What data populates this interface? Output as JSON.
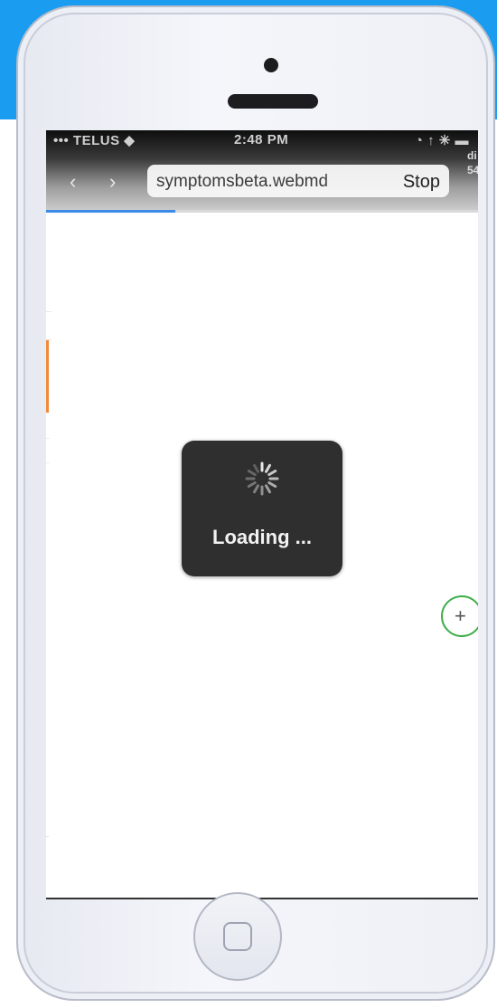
{
  "status_bar": {
    "carrier": "••• TELUS ◆",
    "time": "2:48 PM",
    "icons_text": "◔ ↑ ✳ ▬",
    "cut_label_1": "di",
    "cut_label_2": "54"
  },
  "browser": {
    "back_icon": "‹",
    "forward_icon": "›",
    "url": "symptomsbeta.webmd",
    "stop_label": "Stop",
    "progress_fraction": 0.3
  },
  "loading": {
    "text": "Loading ..."
  },
  "fab": {
    "label": "+"
  },
  "colors": {
    "accent_background": "#1a9cf0",
    "progress": "#3d8ae6",
    "fab_border": "#3fae4a",
    "hud": "#2f2f2f"
  },
  "icons": {
    "camera": "camera-icon",
    "speaker": "speaker-icon",
    "spinner": "spinner-icon",
    "home": "home-button-icon"
  }
}
